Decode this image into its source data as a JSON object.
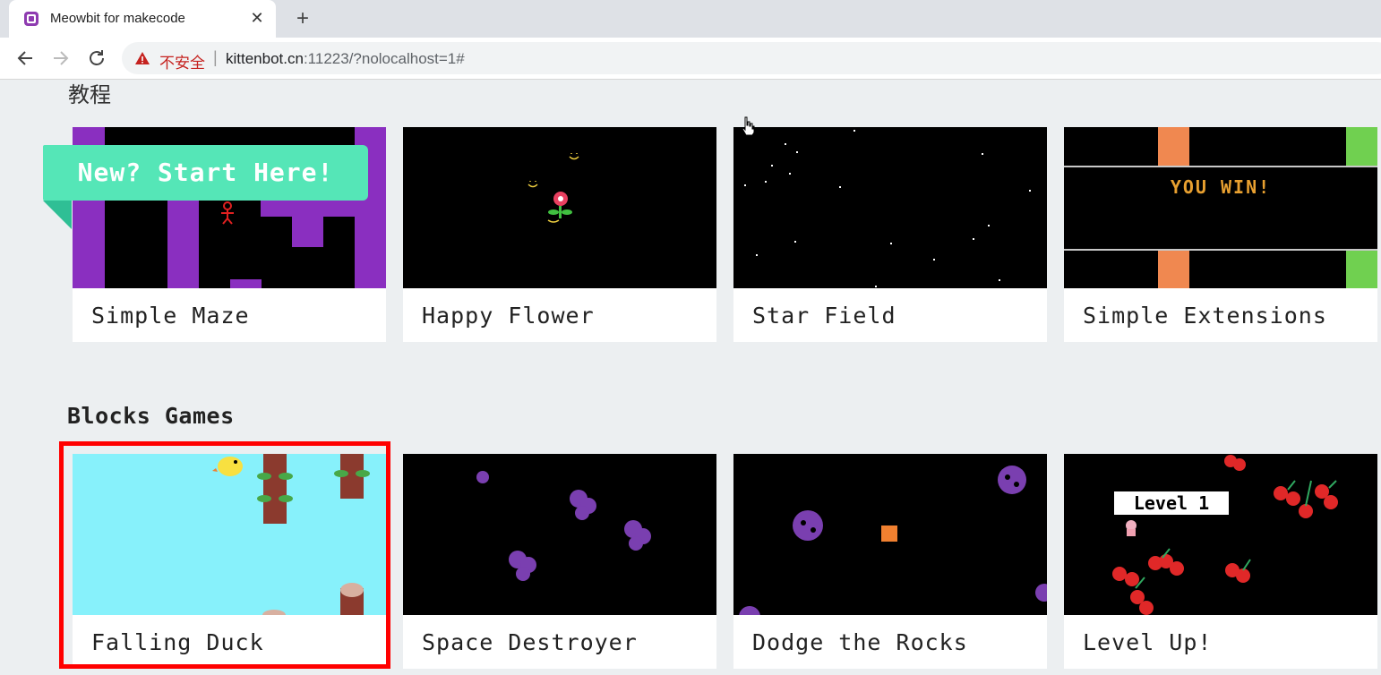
{
  "browser": {
    "tab_title": "Meowbit for makecode",
    "tab_close": "✕",
    "new_tab": "+",
    "security_label": "不安全",
    "separator": "|",
    "url_host": "kittenbot.cn",
    "url_rest": ":11223/?nolocalhost=1#"
  },
  "sections": {
    "tutorials_title": "教程",
    "blocks_games_title": "Blocks Games"
  },
  "tutorials": [
    {
      "label": "Simple Maze",
      "banner": "New? Start Here!"
    },
    {
      "label": "Happy Flower"
    },
    {
      "label": "Star Field"
    },
    {
      "label": "Simple Extensions",
      "thumb_text": "YOU WIN!"
    }
  ],
  "games": [
    {
      "label": "Falling Duck"
    },
    {
      "label": "Space Destroyer"
    },
    {
      "label": "Dodge the Rocks"
    },
    {
      "label": "Level Up!",
      "thumb_text": "Level 1"
    }
  ],
  "colors": {
    "page_bg": "#eceff1",
    "ribbon": "#55e6b7",
    "highlight": "#ff0000",
    "maze_wall": "#8a2fc0",
    "duck_sky": "#87f1fb"
  }
}
